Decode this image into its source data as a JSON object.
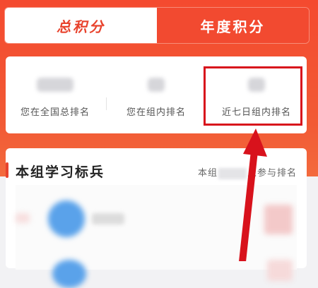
{
  "tabs": [
    {
      "label": "总积分",
      "active": true
    },
    {
      "label": "年度积分",
      "active": false
    }
  ],
  "rank": {
    "national_label": "您在全国总排名",
    "group_label": "您在组内排名",
    "recent_label": "近七日组内排名"
  },
  "group": {
    "title": "本组学习标兵",
    "sub_prefix": "本组",
    "sub_suffix": "人参与排名"
  },
  "colors": {
    "accent": "#f24a30",
    "highlight": "#d8121c",
    "avatar": "#5aa2ea"
  }
}
